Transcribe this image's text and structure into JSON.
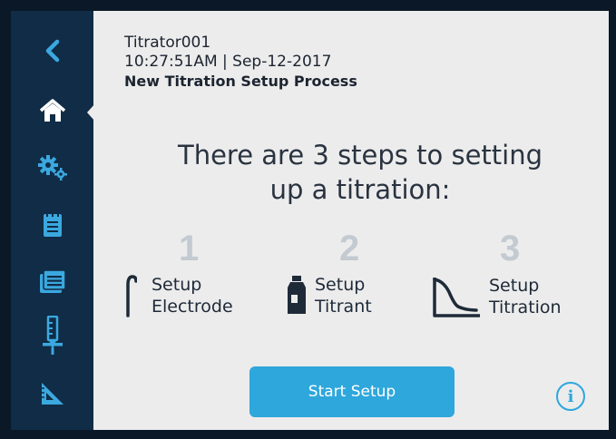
{
  "header": {
    "device_name": "Titrator001",
    "datetime": "10:27:51AM | Sep-12-2017",
    "process_title": "New Titration Setup Process"
  },
  "headline": {
    "line1": "There are 3 steps to setting",
    "line2": "up a titration:"
  },
  "steps": [
    {
      "number": "1",
      "label_line1": "Setup",
      "label_line2": "Electrode",
      "icon": "electrode-icon"
    },
    {
      "number": "2",
      "label_line1": "Setup",
      "label_line2": "Titrant",
      "icon": "titrant-bottle-icon"
    },
    {
      "number": "3",
      "label_line1": "Setup",
      "label_line2": "Titration",
      "icon": "titration-curve-icon"
    }
  ],
  "start_button_label": "Start Setup",
  "info_label": "i",
  "sidebar": {
    "items": [
      "back-icon",
      "home-icon",
      "settings-icon",
      "notepad-icon",
      "methods-icon",
      "burette-icon",
      "ruler-triangle-icon"
    ],
    "active": "home-icon"
  },
  "colors": {
    "accent": "#2ea7dc",
    "sidebar_bg": "#102c47",
    "screen_bg": "#ececec",
    "step_number": "#c3cad1"
  }
}
